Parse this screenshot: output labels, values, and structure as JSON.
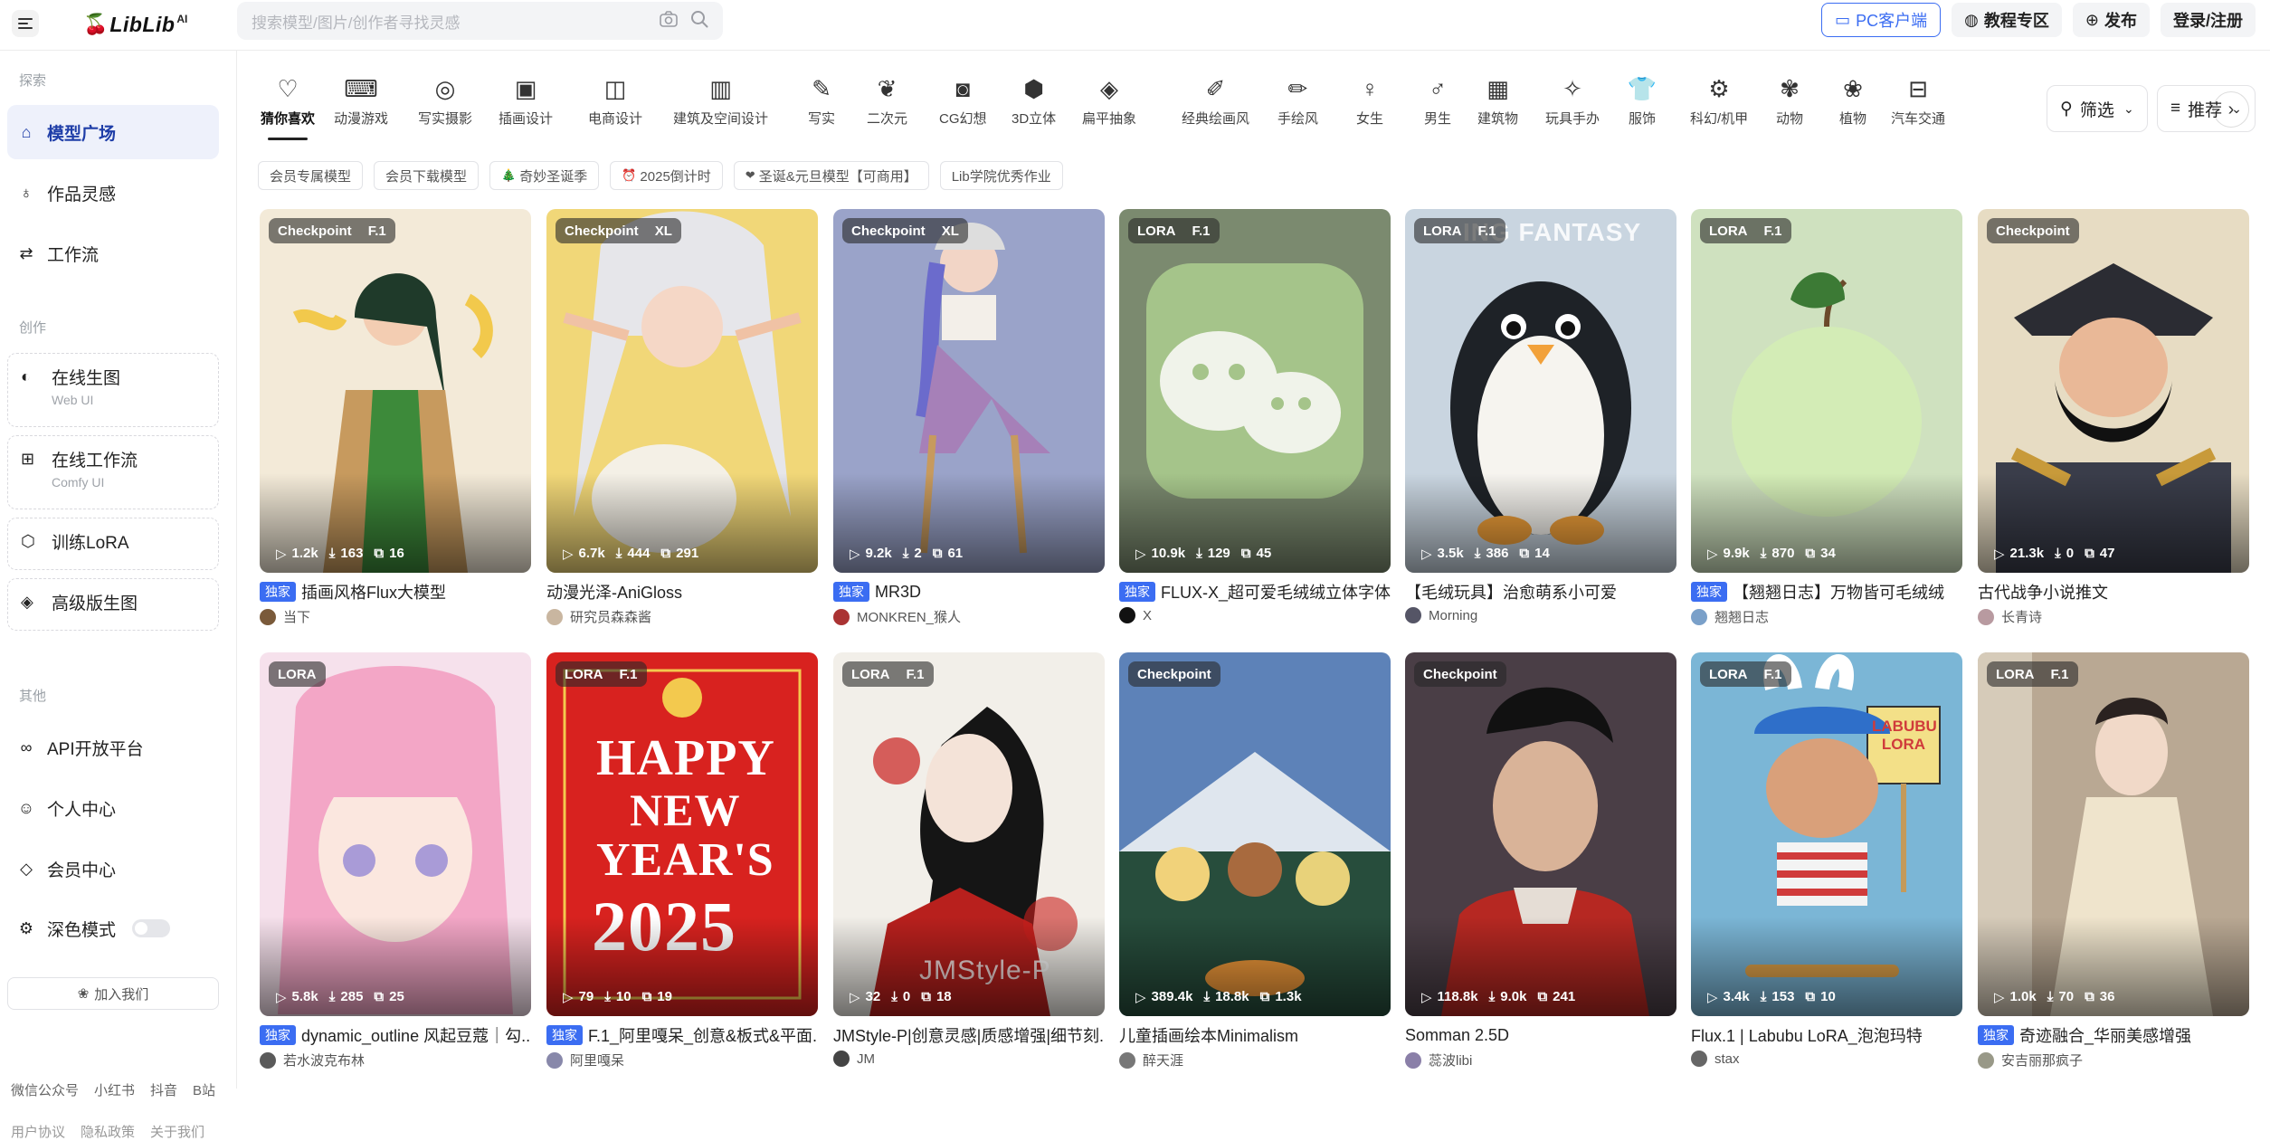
{
  "header": {
    "logo": "LibLib",
    "logo_sup": "AI",
    "search_placeholder": "搜索模型/图片/创作者寻找灵感",
    "buttons": {
      "pc": "PC客户端",
      "tutorial": "教程专区",
      "publish": "发布",
      "login": "登录/注册"
    }
  },
  "sidebar": {
    "section_explore": "探索",
    "explore_items": [
      "模型广场",
      "作品灵感",
      "工作流"
    ],
    "section_create": "创作",
    "create_items": [
      {
        "label": "在线生图",
        "sub": "Web UI"
      },
      {
        "label": "在线工作流",
        "sub": "Comfy UI"
      },
      {
        "label": "训练LoRA",
        "sub": ""
      },
      {
        "label": "高级版生图",
        "sub": ""
      }
    ],
    "section_other": "其他",
    "other_items": [
      "API开放平台",
      "个人中心",
      "会员中心",
      "深色模式"
    ],
    "join": "加入我们",
    "footer_links_1": [
      "微信公众号",
      "小红书",
      "抖音",
      "B站"
    ],
    "footer_links_2": [
      "用户协议",
      "隐私政策",
      "关于我们"
    ]
  },
  "categories": [
    "猜你喜欢",
    "动漫游戏",
    "写实摄影",
    "插画设计",
    "电商设计",
    "建筑及空间设计",
    "写实",
    "二次元",
    "CG幻想",
    "3D立体",
    "扁平抽象",
    "经典绘画风",
    "手绘风",
    "女生",
    "男生",
    "建筑物",
    "玩具手办",
    "服饰",
    "科幻/机甲",
    "动物",
    "植物",
    "汽车交通"
  ],
  "category_icons": [
    "heart-icon",
    "gamepad-icon",
    "camera-icon",
    "image-icon",
    "bag-icon",
    "building-icon",
    "pen-icon",
    "blob-icon",
    "cg-icon",
    "cube-icon",
    "layers-icon",
    "brush-icon",
    "pencil-icon",
    "female-icon",
    "male-icon",
    "house-icon",
    "toy-icon",
    "shirt-icon",
    "robot-icon",
    "paw-icon",
    "plant-icon",
    "car-icon"
  ],
  "filter_label": "筛选",
  "sort_label": "推荐",
  "tags": [
    "会员专属模型",
    "会员下载模型",
    "奇妙圣诞季",
    "2025倒计时",
    "圣诞&元旦模型【可商用】",
    "Lib学院优秀作业"
  ],
  "cards": [
    {
      "type": "Checkpoint",
      "ver": "F.1",
      "views": "1.2k",
      "downloads": "163",
      "images": "16",
      "exclusive": "独家",
      "title": "插画风格Flux大模型",
      "author": "当下"
    },
    {
      "type": "Checkpoint",
      "ver": "XL",
      "views": "6.7k",
      "downloads": "444",
      "images": "291",
      "exclusive": "",
      "title": "动漫光泽-AniGloss",
      "author": "研究员森森酱"
    },
    {
      "type": "Checkpoint",
      "ver": "XL",
      "views": "9.2k",
      "downloads": "2",
      "images": "61",
      "exclusive": "独家",
      "title": "MR3D",
      "author": "MONKREN_猴人"
    },
    {
      "type": "LORA",
      "ver": "F.1",
      "views": "10.9k",
      "downloads": "129",
      "images": "45",
      "exclusive": "独家",
      "title": "FLUX-X_超可爱毛绒绒立体字体",
      "author": "X"
    },
    {
      "type": "LORA",
      "ver": "F.1",
      "views": "3.5k",
      "downloads": "386",
      "images": "14",
      "exclusive": "",
      "title": "【毛绒玩具】治愈萌系小可爱",
      "author": "Morning"
    },
    {
      "type": "LORA",
      "ver": "F.1",
      "views": "9.9k",
      "downloads": "870",
      "images": "34",
      "exclusive": "独家",
      "title": "【翘翘日志】万物皆可毛绒绒",
      "author": "翘翘日志"
    },
    {
      "type": "Checkpoint",
      "ver": "",
      "views": "21.3k",
      "downloads": "0",
      "images": "47",
      "exclusive": "",
      "title": "古代战争小说推文",
      "author": "长青诗"
    },
    {
      "type": "LORA",
      "ver": "",
      "views": "5.8k",
      "downloads": "285",
      "images": "25",
      "exclusive": "独家",
      "title": "dynamic_outline 风起豆蔻｜勾...",
      "author": "若水波克布林"
    },
    {
      "type": "LORA",
      "ver": "F.1",
      "views": "79",
      "downloads": "10",
      "images": "19",
      "exclusive": "独家",
      "title": "F.1_阿里嘎呆_创意&板式&平面...",
      "author": "阿里嘎呆"
    },
    {
      "type": "LORA",
      "ver": "F.1",
      "views": "32",
      "downloads": "0",
      "images": "18",
      "exclusive": "",
      "title": "JMStyle-P|创意灵感|质感增强|细节刻...",
      "author": "JM"
    },
    {
      "type": "Checkpoint",
      "ver": "",
      "views": "389.4k",
      "downloads": "18.8k",
      "images": "1.3k",
      "exclusive": "",
      "title": "儿童插画绘本Minimalism",
      "author": "醉天涯"
    },
    {
      "type": "Checkpoint",
      "ver": "",
      "views": "118.8k",
      "downloads": "9.0k",
      "images": "241",
      "exclusive": "",
      "title": "Somman 2.5D",
      "author": "蕊波libi"
    },
    {
      "type": "LORA",
      "ver": "F.1",
      "views": "3.4k",
      "downloads": "153",
      "images": "10",
      "exclusive": "",
      "title": "Flux.1 | Labubu LoRA_泡泡玛特",
      "author": "stax"
    },
    {
      "type": "LORA",
      "ver": "F.1",
      "views": "1.0k",
      "downloads": "70",
      "images": "36",
      "exclusive": "独家",
      "title": "奇迹融合_华丽美感增强",
      "author": "安吉丽那疯子"
    }
  ],
  "overlay_texts": {
    "penguin": "ING FANTASY",
    "newyear_1": "HAPPY",
    "newyear_2": "NEW",
    "newyear_3": "YEAR'S",
    "newyear_4": "2025",
    "jm": "JMStyle-P",
    "labubu": "LABUBU LORA"
  },
  "colors": {
    "accent": "#3b6df2",
    "exclusive_bg": "#3b6df2",
    "active_bg": "#eef1fb"
  }
}
